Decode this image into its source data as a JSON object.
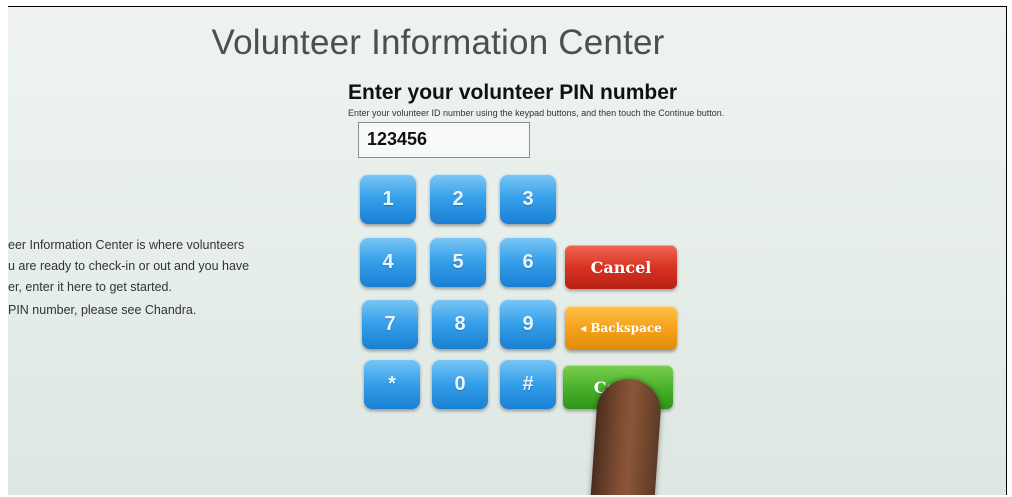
{
  "title": "Volunteer Information Center",
  "pin": {
    "heading": "Enter your volunteer PIN number",
    "instructions": "Enter your volunteer ID number using the keypad buttons, and then touch the Continue button.",
    "value": "123456"
  },
  "info": {
    "line1": "eer Information Center is where volunteers",
    "line2": "u are ready to check-in or out and you have",
    "line3": "er, enter it here to get started.",
    "line4": "PIN number, please see Chandra."
  },
  "keypad": {
    "k1": "1",
    "k2": "2",
    "k3": "3",
    "k4": "4",
    "k5": "5",
    "k6": "6",
    "k7": "7",
    "k8": "8",
    "k9": "9",
    "kstar": "*",
    "k0": "0",
    "khash": "#"
  },
  "actions": {
    "cancel": "Cancel",
    "backspace": "◂ Backspace",
    "continue": "Conti"
  },
  "colors": {
    "key_blue": "#36a0ea",
    "cancel_red": "#d83424",
    "backspace_orange": "#f5a21b",
    "continue_green": "#4bb22c"
  }
}
